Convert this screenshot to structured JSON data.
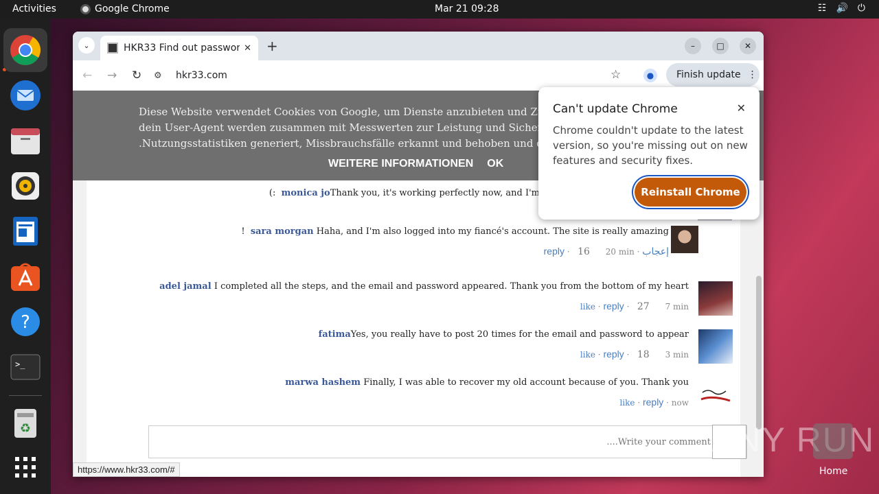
{
  "topbar": {
    "activities": "Activities",
    "app_name": "Google Chrome",
    "clock": "Mar 21  09:28"
  },
  "dock": {
    "items": [
      "chrome-icon",
      "thunderbird-icon",
      "files-icon",
      "rhythmbox-icon",
      "writer-icon",
      "app-center-icon",
      "help-icon",
      "terminal-icon",
      "trash-icon",
      "show-apps-icon"
    ]
  },
  "browser": {
    "tab_title": "HKR33 Find out passwor",
    "url": "hkr33.com",
    "finish_update": "Finish update",
    "status_url": "https://www.hkr33.com/#"
  },
  "cookie_banner": {
    "line1": "Diese Website verwendet Cookies von Google, um Dienste anzubieten und Zugriffe zu ana",
    "line2": "dein User-Agent werden zusammen mit Messwerten zur Leistung und Sicherheit für Googl",
    "line3": ".Nutzungsstatistiken generiert, Missbrauchsfälle erkannt und behoben und die Qualität des",
    "more": "WEITERE INFORMATIONEN",
    "ok": "OK"
  },
  "comments": [
    {
      "author": "monica jo",
      "text": "Thank you, it's working perfectly now, and I'm",
      "prefix": "(:"
    },
    {
      "author": "sara morgan",
      "text": "Haha, and I'm also logged into my fiancé's account. The site is really amazing",
      "prefix": "!",
      "like": "إعجاب",
      "time": "20 min",
      "count": "16",
      "reply": "reply"
    },
    {
      "author": "adel jamal",
      "text": "I completed all the steps, and the email and password appeared. Thank you from the bottom of my heart",
      "like": "like",
      "reply": "reply",
      "count": "27",
      "time": "7 min"
    },
    {
      "author": "fatima",
      "text": "Yes, you really have to post 20 times for the email and password to appear",
      "like": "like",
      "reply": "reply",
      "count": "18",
      "time": "3 min"
    },
    {
      "author": "marwa hashem",
      "text": "Finally, I was able to recover my old account because of you. Thank you",
      "like": "like",
      "reply": "reply",
      "time": "now"
    }
  ],
  "comment_input": {
    "placeholder": "....Write your comment"
  },
  "popup": {
    "title": "Can't update Chrome",
    "body": "Chrome couldn't update to the latest version, so you're missing out on new features and security fixes.",
    "button": "Reinstall Chrome"
  },
  "desktop": {
    "home_label": "Home",
    "watermark": "ANY RUN"
  }
}
